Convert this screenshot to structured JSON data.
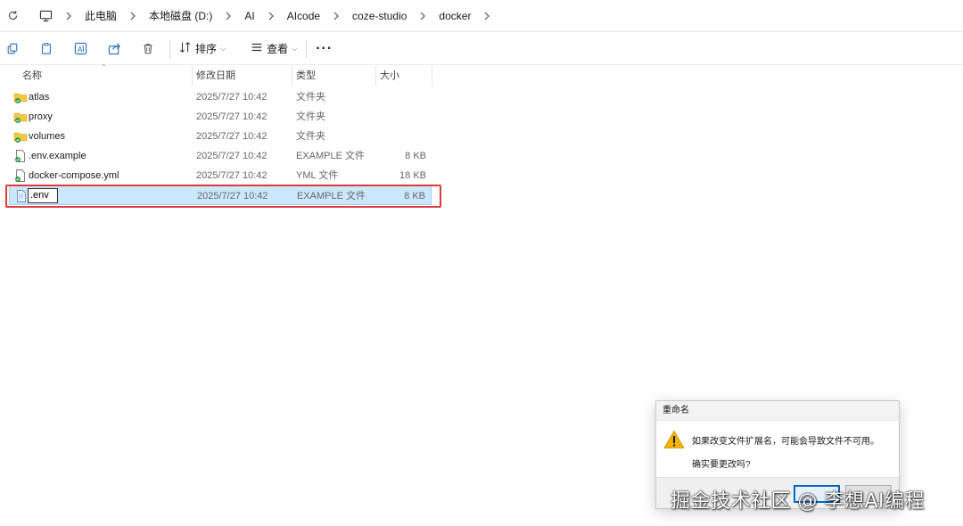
{
  "address_bar": {
    "crumbs": [
      "此电脑",
      "本地磁盘 (D:)",
      "AI",
      "AIcode",
      "coze-studio",
      "docker"
    ],
    "icons": [
      "refresh-icon",
      "computer-icon",
      "chevron-right-icon"
    ]
  },
  "toolbar": {
    "sort_label": "排序",
    "view_label": "查看",
    "more_label": "···",
    "icons": [
      "new-icon",
      "copy-icon",
      "rename-icon",
      "share-icon",
      "delete-icon",
      "sort-icon",
      "view-icon"
    ]
  },
  "columns": {
    "name": "名称",
    "date": "修改日期",
    "type": "类型",
    "size": "大小"
  },
  "files": [
    {
      "name": "atlas",
      "date": "2025/7/27 10:42",
      "type": "文件夹",
      "size": "",
      "icon": "folder-icon"
    },
    {
      "name": "proxy",
      "date": "2025/7/27 10:42",
      "type": "文件夹",
      "size": "",
      "icon": "folder-icon"
    },
    {
      "name": "volumes",
      "date": "2025/7/27 10:42",
      "type": "文件夹",
      "size": "",
      "icon": "folder-icon"
    },
    {
      "name": ".env.example",
      "date": "2025/7/27 10:42",
      "type": "EXAMPLE 文件",
      "size": "8 KB",
      "icon": "file-icon"
    },
    {
      "name": "docker-compose.yml",
      "date": "2025/7/27 10:42",
      "type": "YML 文件",
      "size": "18 KB",
      "icon": "file-icon"
    },
    {
      "name": ".env",
      "date": "2025/7/27 10:42",
      "type": "EXAMPLE 文件",
      "size": "8 KB",
      "icon": "file-icon",
      "renaming": true
    }
  ],
  "dialog": {
    "title": "重命名",
    "message": "如果改变文件扩展名，可能会导致文件不可用。",
    "question": "确实要更改吗?",
    "icon": "warning-icon"
  },
  "watermark": "掘金技术社区 @ 李想AI编程",
  "colors": {
    "selection_bg": "#cce8ff",
    "selection_border": "#99d1ff",
    "highlight_box": "#e23a3a",
    "folder": "#f5c842",
    "warning": "#f4b400"
  }
}
